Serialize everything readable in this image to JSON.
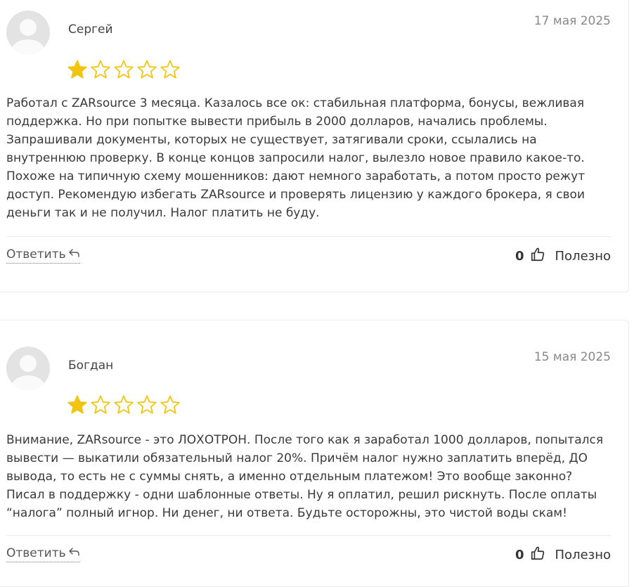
{
  "reviews": [
    {
      "author": "Сергей",
      "date": "17 мая 2025",
      "rating": 1,
      "rating_max": 5,
      "text": "Работал с ZARsource 3 месяца. Казалось все ок: стабильная платформа, бонусы, вежливая поддержка. Но при попытке вывести прибыль в 2000 долларов, начались проблемы. Запрашивали документы, которых не существует, затягивали сроки, ссылались на внутреннюю проверку. В конце концов запросили налог, вылезло новое правило какое-то. Похоже на типичную схему мошенников: дают немного заработать, а потом просто режут доступ. Рекомендую избегать ZARsource и проверять лицензию у каждого брокера, я свои деньги так и не получил. Налог платить не буду.",
      "reply_label": "Ответить",
      "useful_count": "0",
      "useful_label": "Полезно"
    },
    {
      "author": "Богдан",
      "date": "15 мая 2025",
      "rating": 1,
      "rating_max": 5,
      "text": "Внимание, ZARsource - это ЛОХОТРОН. После того как я заработал 1000 долларов, попытался вывести — выкатили обязательный налог 20%. Причём налог нужно заплатить вперёд, ДО вывода, то есть не с суммы снять, а именно отдельным платежом! Это вообще законно? Писал в поддержку - одни шаблонные ответы. Ну я оплатил, решил рискнуть. После оплаты “налога” полный игнор. Ни денег, ни ответа. Будьте осторожны, это чистой воды скам!",
      "reply_label": "Ответить",
      "useful_count": "0",
      "useful_label": "Полезно"
    }
  ],
  "colors": {
    "star_filled": "#f1c40f",
    "star_outline": "#f1c40f"
  },
  "icons": {
    "reply": "reply-arrow-icon",
    "thumb": "thumbs-up-icon",
    "avatar": "user-avatar-icon"
  }
}
